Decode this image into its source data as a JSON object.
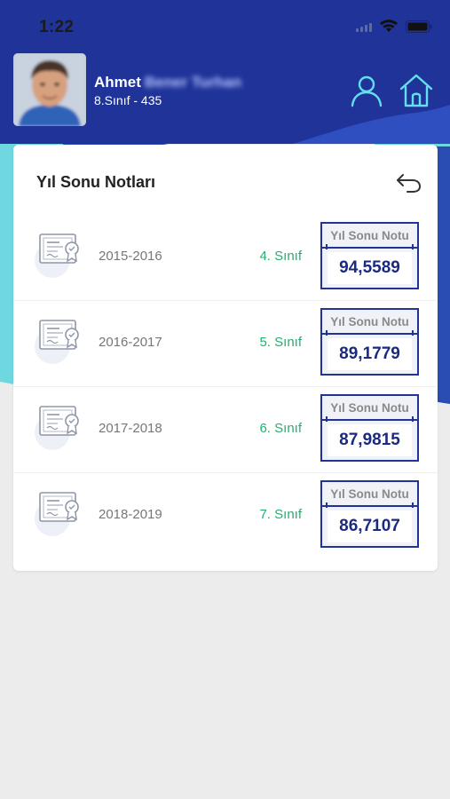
{
  "status_bar": {
    "time": "1:22",
    "icons": [
      "signal-icon",
      "wifi-icon",
      "battery-icon"
    ]
  },
  "header": {
    "first_name": "Ahmet",
    "last_name": "Bener Turhan",
    "class_info": "8.Sınıf - 435",
    "actions": [
      "profile-icon",
      "home-icon"
    ]
  },
  "page": {
    "title": "Yıl Sonu Notları",
    "back_icon": "undo-arrow-icon"
  },
  "grades": [
    {
      "year": "2015-2016",
      "grade": "4. Sınıf",
      "score_label": "Yıl Sonu Notu",
      "score": "94,5589"
    },
    {
      "year": "2016-2017",
      "grade": "5. Sınıf",
      "score_label": "Yıl Sonu Notu",
      "score": "89,1779"
    },
    {
      "year": "2017-2018",
      "grade": "6. Sınıf",
      "score_label": "Yıl Sonu Notu",
      "score": "87,9815"
    },
    {
      "year": "2018-2019",
      "grade": "7. Sınıf",
      "score_label": "Yıl Sonu Notu",
      "score": "86,7107"
    }
  ],
  "colors": {
    "header_blue": "#1f3399",
    "wave_cyan": "#6fd7e0",
    "accent_green": "#23b06f",
    "score_navy": "#1a2a80"
  }
}
